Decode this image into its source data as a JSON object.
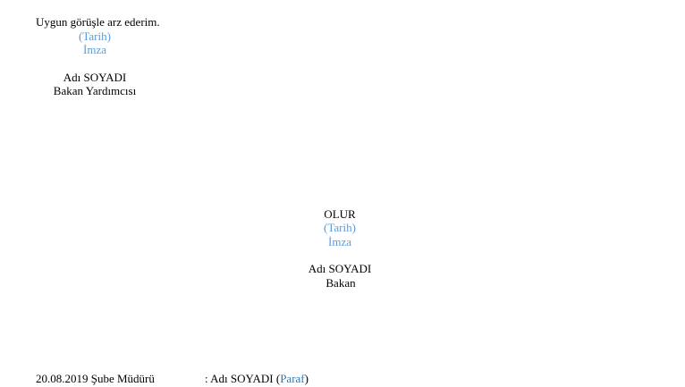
{
  "colors": {
    "placeholder": "#5b9bd5",
    "paraf": "#2e75b6",
    "text": "#000000"
  },
  "recommendation": {
    "text": "Uygun görüşle arz ederim.",
    "date_placeholder": "(Tarih)",
    "signature_placeholder": "İmza",
    "name": "Adı SOYADI",
    "title": "Bakan Yardımcısı"
  },
  "approval": {
    "label": "OLUR",
    "date_placeholder": "(Tarih)",
    "signature_placeholder": "İmza",
    "name": "Adı SOYADI",
    "title": "Bakan"
  },
  "footer": {
    "date_and_role": "20.08.2019 Şube Müdürü",
    "separator": ":",
    "name": "Adı SOYADI",
    "paren_open": "(",
    "paraf": "Paraf",
    "paren_close": ")"
  }
}
